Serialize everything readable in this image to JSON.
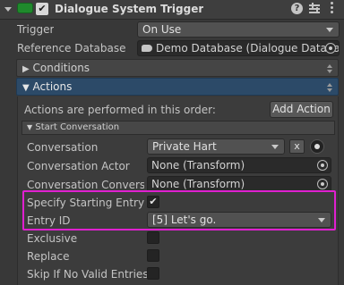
{
  "header": {
    "title": "Dialogue System Trigger",
    "enabled": true
  },
  "trigger": {
    "label": "Trigger",
    "value": "On Use"
  },
  "reference_db": {
    "label": "Reference Database",
    "value": "Demo Database (Dialogue Databa"
  },
  "conditions": {
    "label": "Conditions",
    "arrow": "▶"
  },
  "actions": {
    "label": "Actions",
    "arrow": "▼",
    "order_text": "Actions are performed in this order:",
    "add_button": "Add Action"
  },
  "start_conversation": {
    "label": "Start Conversation",
    "arrow": "▼",
    "conversation": {
      "label": "Conversation",
      "value": "Private Hart",
      "clear": "x"
    },
    "conversation_actor": {
      "label": "Conversation Actor",
      "value": "None (Transform)"
    },
    "conversation_conversant": {
      "label": "Conversation Conversa",
      "value": "None (Transform)"
    },
    "specify_starting_entry": {
      "label": "Specify Starting Entry",
      "checked": true,
      "check_glyph": "✔"
    },
    "entry_id": {
      "label": "Entry ID",
      "value": "[5] Let's go."
    },
    "exclusive": {
      "label": "Exclusive",
      "checked": false
    },
    "replace": {
      "label": "Replace",
      "checked": false
    },
    "skip_if_no_valid": {
      "label": "Skip If No Valid Entries",
      "checked": false
    }
  },
  "colors": {
    "highlight_box": "#e020d0",
    "actions_header": "#2c4a68",
    "background": "#383838"
  },
  "icons": [
    "foldout-arrow-icon",
    "component-toggle-icon",
    "help-icon",
    "preset-icon",
    "more-menu-icon",
    "database-icon",
    "object-picker-icon",
    "reorder-icon"
  ]
}
